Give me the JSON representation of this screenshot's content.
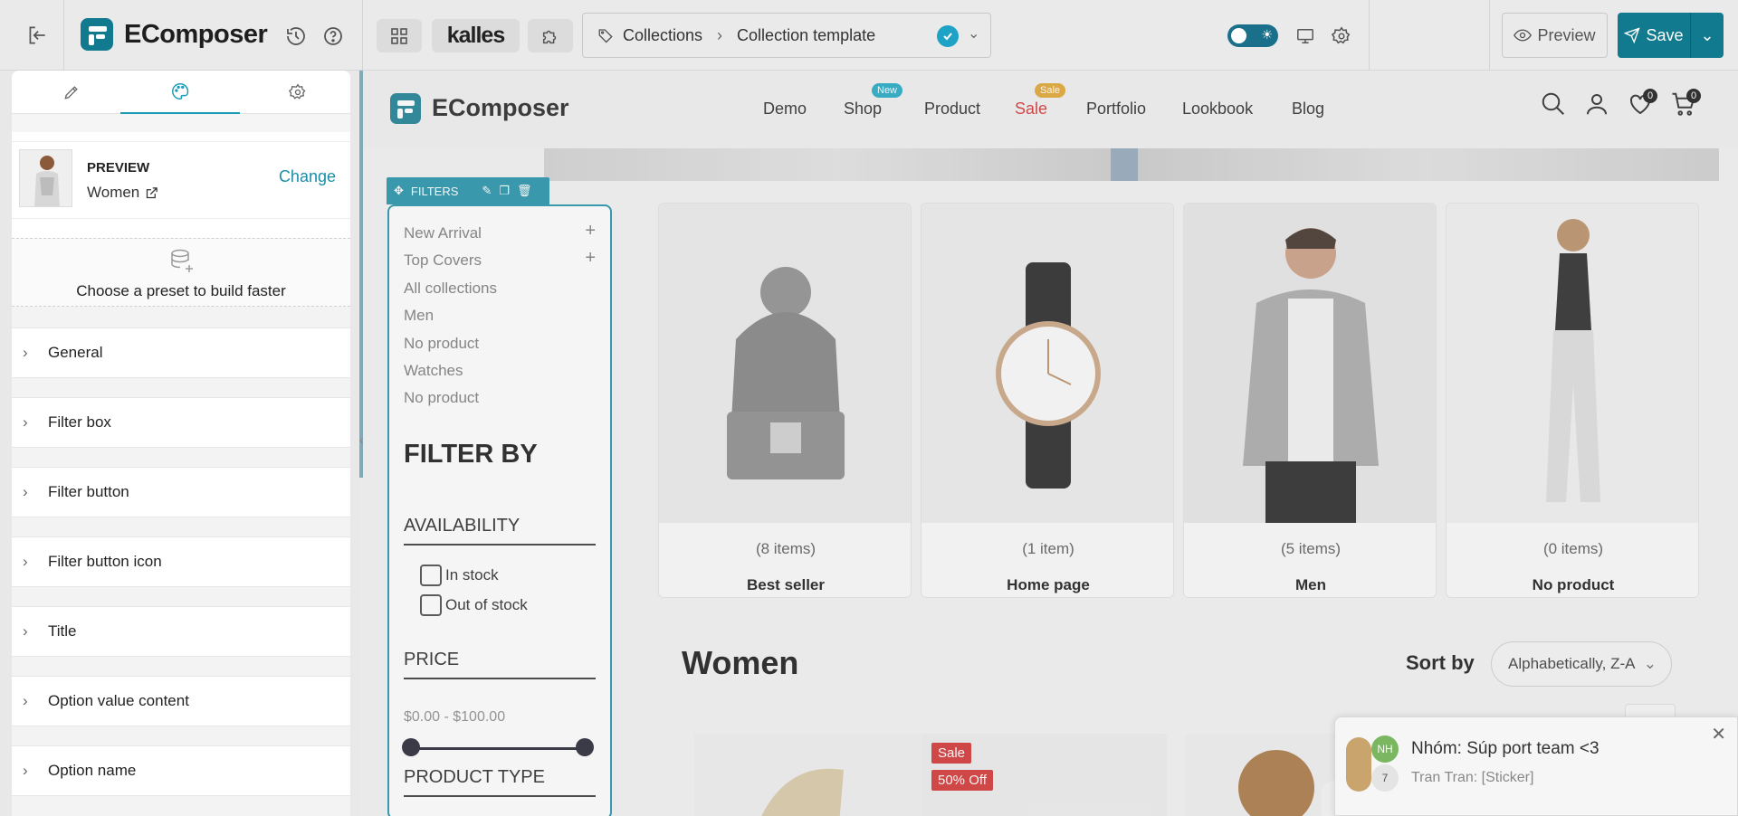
{
  "app": {
    "brand": "EComposer",
    "theme_name": "kalles",
    "accent": "#117a8f"
  },
  "topbar": {
    "breadcrumb": [
      "Collections",
      "Collection template"
    ],
    "preview_label": "Preview",
    "save_label": "Save"
  },
  "panel": {
    "preview_label": "PREVIEW",
    "preview_name": "Women",
    "change_label": "Change",
    "preset_text": "Choose a preset to build faster",
    "sections": [
      "General",
      "Filter box",
      "Filter button",
      "Filter button icon",
      "Title",
      "Option value content",
      "Option name"
    ]
  },
  "store": {
    "brand": "EComposer",
    "nav": [
      "Demo",
      "Shop",
      "Product",
      "Sale",
      "Portfolio",
      "Lookbook",
      "Blog"
    ],
    "shop_badge": "New",
    "sale_badge": "Sale",
    "wishlist_count": "0",
    "cart_count": "0"
  },
  "filters": {
    "tag_label": "FILTERS",
    "links": [
      "New Arrival",
      "Top Covers",
      "All collections",
      "Men",
      "No product",
      "Watches",
      "No product"
    ],
    "title": "FILTER BY",
    "availability_label": "AVAILABILITY",
    "in_stock": "In stock",
    "out_of_stock": "Out of stock",
    "price_label": "PRICE",
    "price_range": "$0.00 - $100.00",
    "product_type_label": "PRODUCT TYPE"
  },
  "collections": [
    {
      "count": "(8 items)",
      "name": "Best seller"
    },
    {
      "count": "(1 item)",
      "name": "Home page"
    },
    {
      "count": "(5 items)",
      "name": "Men"
    },
    {
      "count": "(0 items)",
      "name": "No product"
    }
  ],
  "listing": {
    "title": "Women",
    "sort_label": "Sort by",
    "sort_value": "Alphabetically, Z-A",
    "sale_badge": "Sale",
    "off_badge": "50% Off"
  },
  "notification": {
    "avatar_initials": "NH",
    "avatar_count": "7",
    "title": "Nhóm: Súp port team <3",
    "subtitle": "Tran Tran: [Sticker]"
  }
}
